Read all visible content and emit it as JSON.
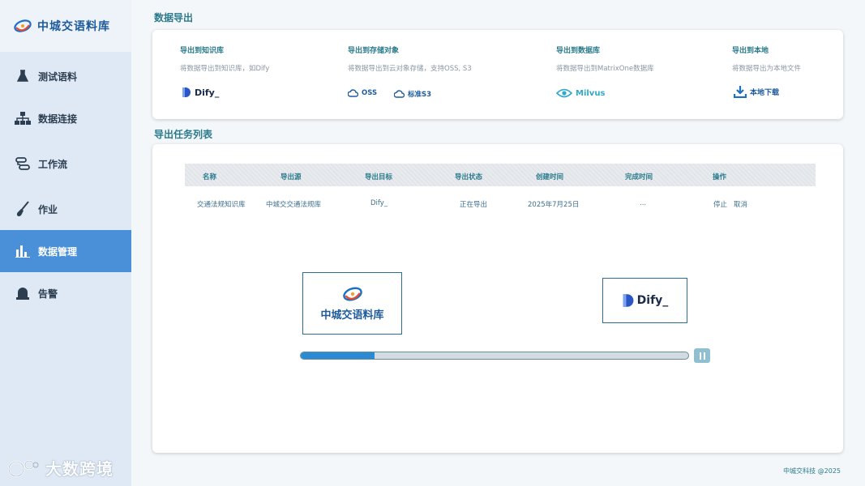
{
  "brand": {
    "name": "中城交语料库"
  },
  "sidebar": {
    "items": [
      {
        "label": "测试语料",
        "icon": "flask-icon",
        "active": false
      },
      {
        "label": "数据连接",
        "icon": "network-icon",
        "active": false
      },
      {
        "label": "工作流",
        "icon": "workflow-icon",
        "active": false
      },
      {
        "label": "作业",
        "icon": "shovel-icon",
        "active": false
      },
      {
        "label": "数据管理",
        "icon": "bar-chart-icon",
        "active": true
      },
      {
        "label": "告警",
        "icon": "alarm-icon",
        "active": false
      }
    ],
    "watermark": "大数跨境"
  },
  "export": {
    "title": "数据导出",
    "kb": {
      "title": "导出到知识库",
      "desc": "将数据导出到知识库，如Dify",
      "btn": "Dify_"
    },
    "storage": {
      "title": "导出到存储对象",
      "desc": "将数据导出到云对象存储，支持OSS, S3",
      "btn1": "OSS",
      "btn2": "标准S3"
    },
    "db": {
      "title": "导出到数据库",
      "desc": "将数据导出到MatrixOne数据库",
      "btn": "Milvus"
    },
    "local": {
      "title": "导出到本地",
      "desc": "将数据导出为本地文件",
      "btn": "本地下载"
    }
  },
  "tasks": {
    "title": "导出任务列表",
    "columns": [
      "名称",
      "导出源",
      "导出目标",
      "导出状态",
      "创建时间",
      "完成时间",
      "操作"
    ],
    "rows": [
      {
        "name": "交通法规知识库",
        "source": "中城交交通法规库",
        "target": "Dify_",
        "status": "正在导出",
        "created": "2025年7月25日",
        "finished": "...",
        "action_stop": "停止",
        "action_cancel": "取消"
      }
    ]
  },
  "animation": {
    "source_label": "中城交语料库",
    "target_label": "Dify_",
    "progress": 0.19
  },
  "footer": {
    "text": "中城交科技 @2025"
  },
  "colors": {
    "accent": "#4a90d9",
    "brand": "#1e5b9c",
    "teal": "#2a7a8c"
  }
}
